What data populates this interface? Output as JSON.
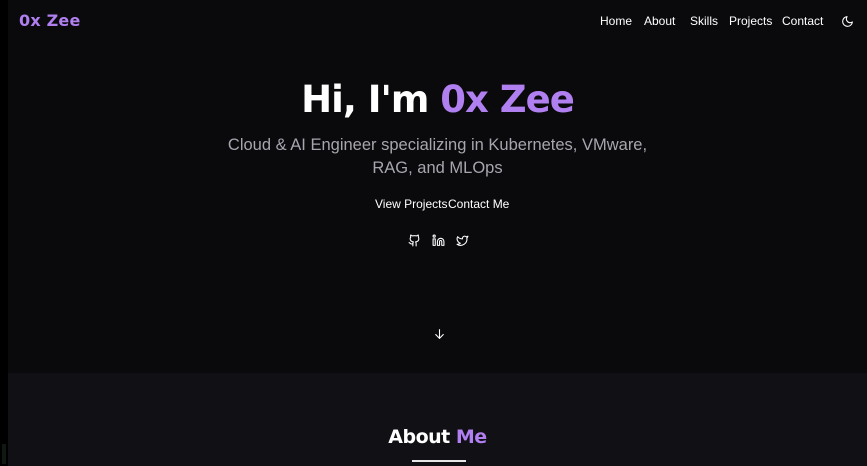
{
  "brand": {
    "name": "0x Zee",
    "accent_color": "#b07ff0"
  },
  "nav": {
    "items": [
      {
        "label": "Home"
      },
      {
        "label": "About"
      },
      {
        "label": "Skills"
      },
      {
        "label": "Projects"
      },
      {
        "label": "Contact"
      }
    ],
    "theme_toggle_icon": "moon-icon"
  },
  "hero": {
    "greeting": "Hi, I'm",
    "name": "0x Zee",
    "subtitle": "Cloud & AI Engineer specializing in Kubernetes, VMware, RAG, and MLOps",
    "buttons": {
      "view_projects": "View Projects",
      "contact_me": "Contact Me"
    },
    "social_icons": [
      "github-icon",
      "linkedin-icon",
      "twitter-icon"
    ],
    "scroll_icon": "arrow-down-icon"
  },
  "about": {
    "title_main": "About",
    "title_accent": "Me"
  },
  "colors": {
    "background": "#0a090c",
    "section_background": "#111015",
    "text": "#ffffff",
    "muted_text": "#a6a6ae"
  }
}
